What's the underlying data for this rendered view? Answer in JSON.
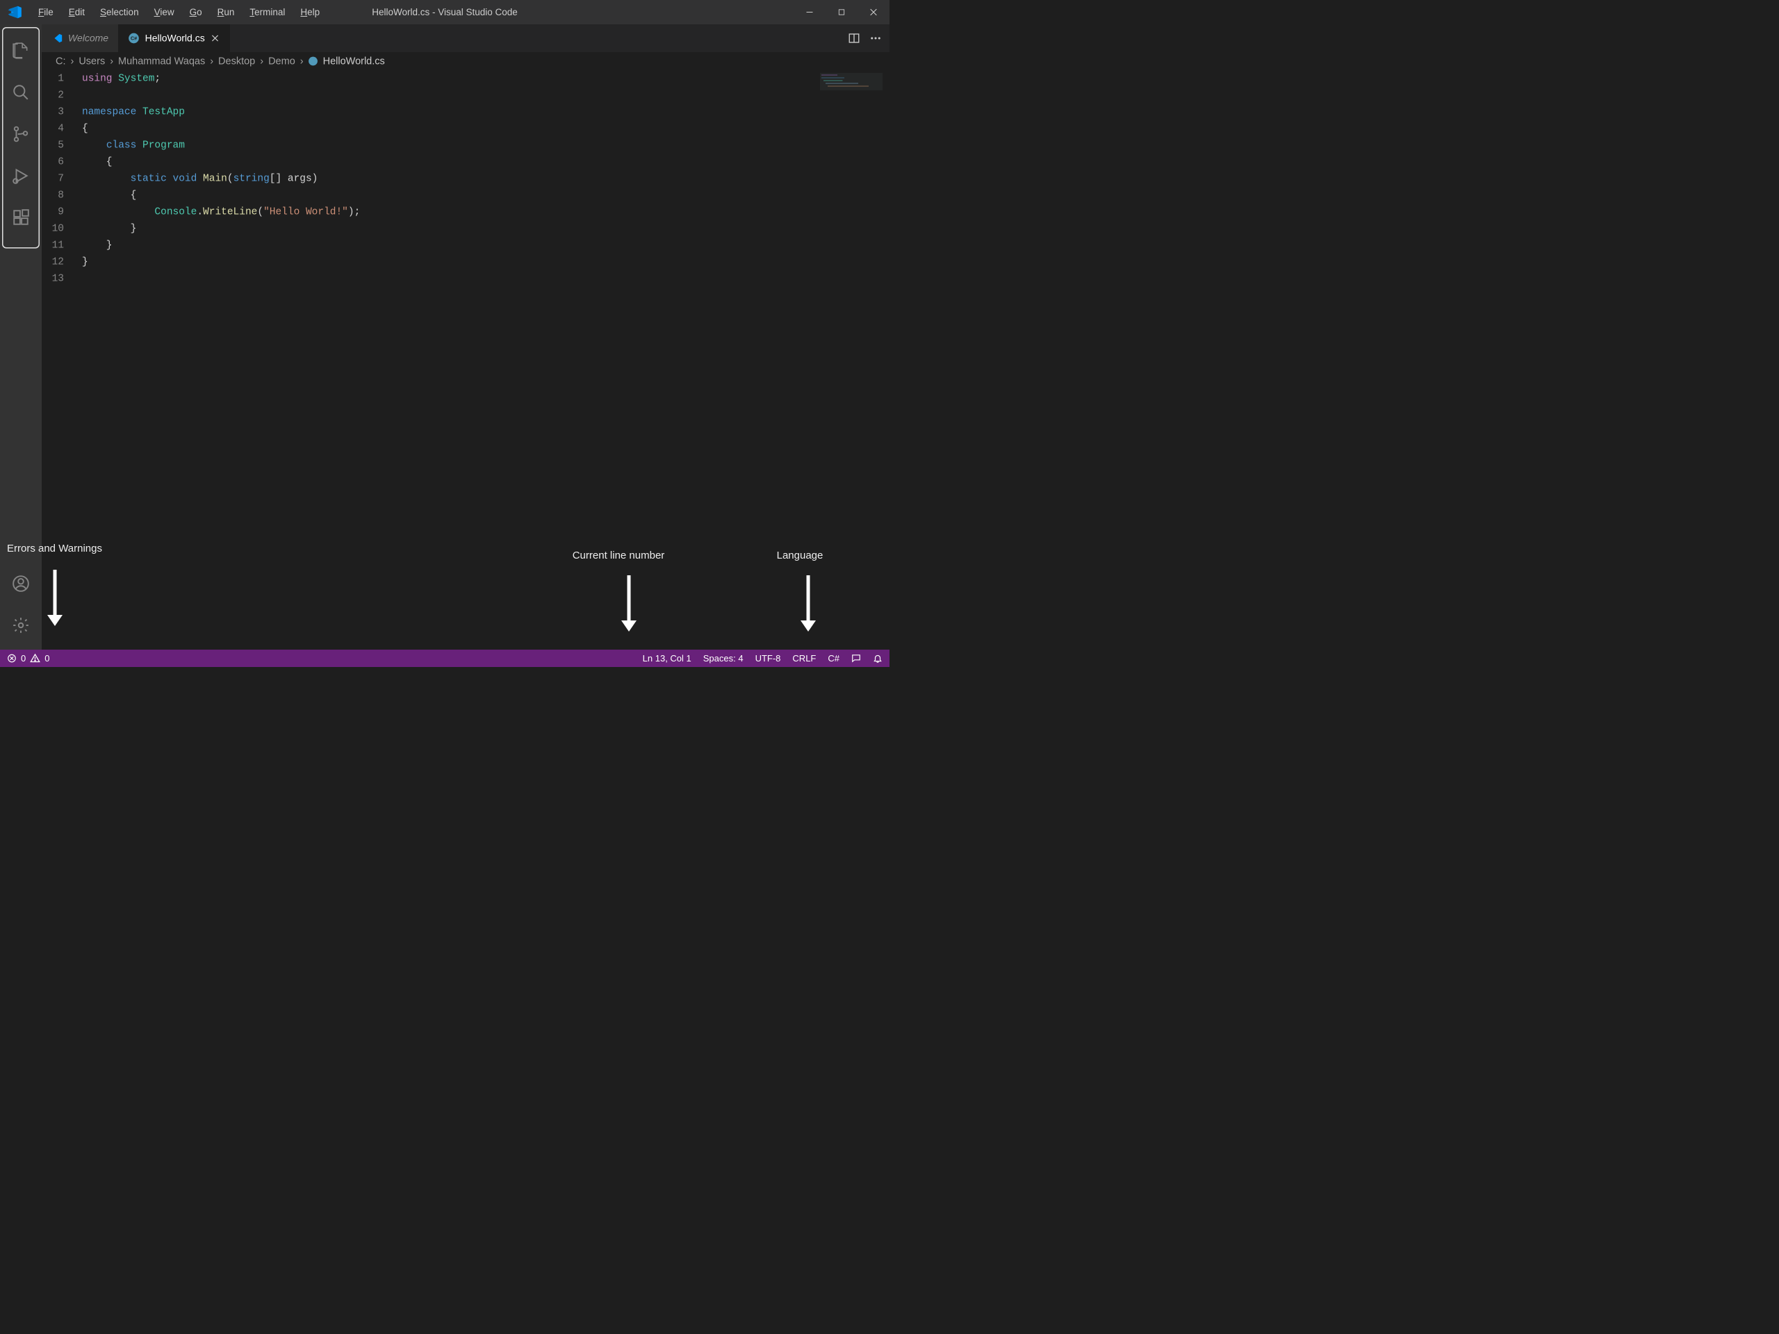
{
  "window": {
    "title": "HelloWorld.cs - Visual Studio Code"
  },
  "menu": {
    "file": "File",
    "edit": "Edit",
    "selection": "Selection",
    "view": "View",
    "go": "Go",
    "run": "Run",
    "terminal": "Terminal",
    "help": "Help"
  },
  "tabs": {
    "welcome": "Welcome",
    "hello": "HelloWorld.cs"
  },
  "breadcrumbs": {
    "c": "C:",
    "users": "Users",
    "mw": "Muhammad Waqas",
    "desktop": "Desktop",
    "demo": "Demo",
    "file": "HelloWorld.cs"
  },
  "code": {
    "l1_using": "using",
    "l1_system": "System",
    "l1_semi": ";",
    "l3_namespace": "namespace",
    "l3_testapp": "TestApp",
    "l4_brace": "{",
    "l5_class": "class",
    "l5_program": "Program",
    "l6_brace": "    {",
    "l7_static": "static",
    "l7_void": "void",
    "l7_main": "Main",
    "l7_paren_open": "(",
    "l7_string": "string",
    "l7_args": "[] args)",
    "l8_brace": "        {",
    "l9_console": "Console",
    "l9_dot": ".",
    "l9_writeline": "WriteLine",
    "l9_paren": "(",
    "l9_str": "\"Hello World!\"",
    "l9_end": ");",
    "l10_brace": "        }",
    "l11_brace": "    }",
    "l12_brace": "}"
  },
  "line_numbers": [
    "1",
    "2",
    "3",
    "4",
    "5",
    "6",
    "7",
    "8",
    "9",
    "10",
    "11",
    "12",
    "13"
  ],
  "status": {
    "errors": "0",
    "warnings": "0",
    "lncol": "Ln 13, Col 1",
    "spaces": "Spaces: 4",
    "encoding": "UTF-8",
    "eol": "CRLF",
    "lang": "C#"
  },
  "annotations": {
    "errors": "Errors and Warnings",
    "line": "Current line number",
    "lang": "Language"
  }
}
